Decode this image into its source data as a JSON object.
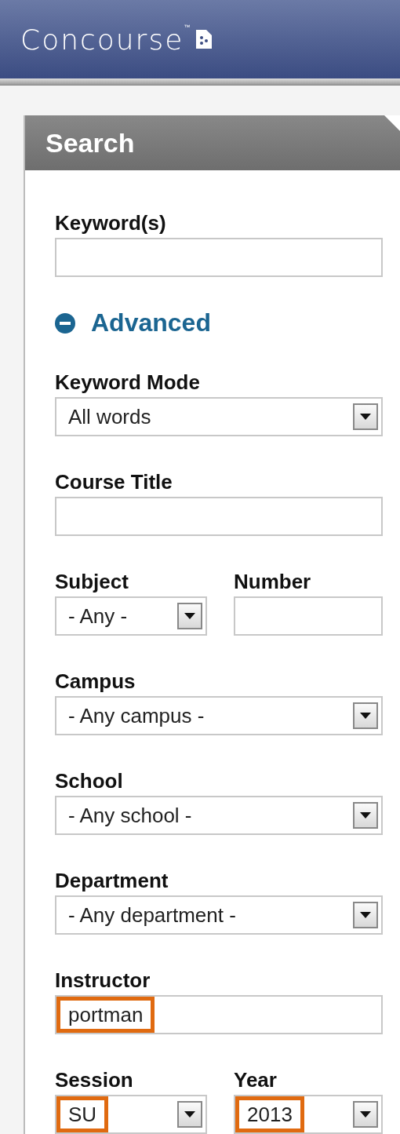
{
  "header": {
    "logo": "Concourse$^{™}$"
  },
  "panel": {
    "title": "Search"
  },
  "keyword": {
    "label": "Keyword(s)"
  },
  "advanced": {
    "label": "Advanced",
    "expanded": true
  },
  "rows": [
    {
      "fields": [
        {
          "kind": "select",
          "label": "Keyword Mode",
          "value": "All words",
          "highlighted": false
        }
      ]
    },
    {
      "fields": [
        {
          "kind": "text",
          "label": "Course Title"
        }
      ]
    },
    {
      "fields": [
        {
          "kind": "select",
          "label": "Subject",
          "value": "- Any -",
          "highlighted": false
        },
        {
          "kind": "text",
          "label": "Number"
        }
      ]
    },
    {
      "fields": [
        {
          "kind": "select",
          "label": "Campus",
          "value": "- Any campus -",
          "highlighted": false
        }
      ]
    },
    {
      "fields": [
        {
          "kind": "select",
          "label": "School",
          "value": "- Any school -",
          "highlighted": false
        }
      ]
    },
    {
      "fields": [
        {
          "kind": "select",
          "label": "Department",
          "value": "- Any department -",
          "highlighted": false
        }
      ]
    },
    {
      "fields": [
        {
          "kind": "text",
          "label": "Instructor",
          "value": "portman",
          "highlighted": true
        }
      ]
    },
    {
      "fields": [
        {
          "kind": "select",
          "label": "Session",
          "value": "SU",
          "highlighted": true
        },
        {
          "kind": "select",
          "label": "Year",
          "value": "2013",
          "highlighted": true
        }
      ]
    }
  ]
}
